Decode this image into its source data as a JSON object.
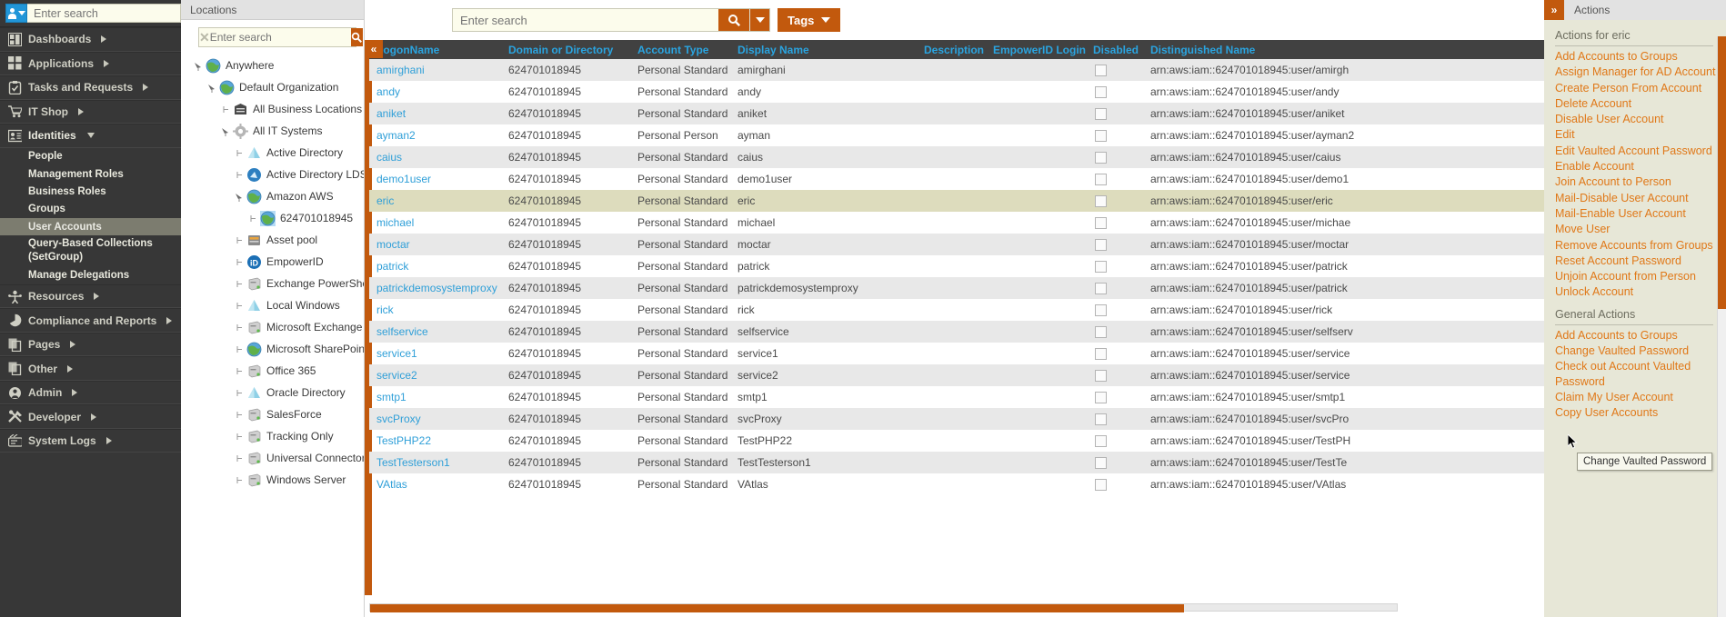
{
  "leftnav": {
    "search_placeholder": "Enter search",
    "avatar_icon": "user-avatar-icon",
    "items": [
      {
        "label": "Dashboards",
        "icon": "dashboard-icon",
        "arrow": "right"
      },
      {
        "label": "Applications",
        "icon": "applications-grid-icon",
        "arrow": "right"
      },
      {
        "label": "Tasks and Requests",
        "icon": "clipboard-icon",
        "arrow": "right"
      },
      {
        "label": "IT Shop",
        "icon": "shopping-cart-icon",
        "arrow": "right"
      },
      {
        "label": "Identities",
        "icon": "identities-card-icon",
        "arrow": "down"
      }
    ],
    "sub_items": [
      {
        "label": "People",
        "selected": false
      },
      {
        "label": "Management Roles",
        "selected": false
      },
      {
        "label": "Business Roles",
        "selected": false
      },
      {
        "label": "Groups",
        "selected": false
      },
      {
        "label": "User Accounts",
        "selected": true
      },
      {
        "label": "Query-Based Collections (SetGroup)",
        "selected": false
      },
      {
        "label": "Manage Delegations",
        "selected": false
      }
    ],
    "items_bottom": [
      {
        "label": "Resources",
        "icon": "resources-person-icon",
        "arrow": "right"
      },
      {
        "label": "Compliance and Reports",
        "icon": "pie-chart-icon",
        "arrow": "right"
      },
      {
        "label": "Pages",
        "icon": "pages-copy-icon",
        "arrow": "right"
      },
      {
        "label": "Other",
        "icon": "other-copy-icon",
        "arrow": "right"
      },
      {
        "label": "Admin",
        "icon": "admin-gear-person-icon",
        "arrow": "right"
      },
      {
        "label": "Developer",
        "icon": "hammer-wrench-icon",
        "arrow": "right"
      },
      {
        "label": "System Logs",
        "icon": "system-logs-icon",
        "arrow": "right"
      }
    ]
  },
  "locations": {
    "title": "Locations",
    "search_placeholder": "Enter search",
    "clear_icon": "clear-x-icon",
    "search_icon": "search-icon",
    "collapse_icon": "collapse-left-icon",
    "tree": [
      {
        "label": "Anywhere",
        "indent": 0,
        "icon": "globe-icon",
        "expanded": true,
        "selected": false
      },
      {
        "label": "Default Organization",
        "indent": 1,
        "icon": "globe-icon",
        "expanded": true,
        "selected": false
      },
      {
        "label": "All Business Locations",
        "indent": 2,
        "icon": "building-icon",
        "expanded": false,
        "selected": false
      },
      {
        "label": "All IT Systems",
        "indent": 2,
        "icon": "gear-icon",
        "expanded": true,
        "selected": false
      },
      {
        "label": "Active Directory",
        "indent": 3,
        "icon": "pyramid-icon",
        "expanded": false,
        "selected": false
      },
      {
        "label": "Active Directory LDS",
        "indent": 3,
        "icon": "blue-globe-icon",
        "expanded": false,
        "selected": false
      },
      {
        "label": "Amazon AWS",
        "indent": 3,
        "icon": "globe-icon",
        "expanded": true,
        "selected": false
      },
      {
        "label": "624701018945",
        "indent": 4,
        "icon": "globe-icon",
        "expanded": false,
        "selected": true
      },
      {
        "label": "Asset pool",
        "indent": 3,
        "icon": "asset-icon",
        "expanded": false,
        "selected": false
      },
      {
        "label": "EmpowerID",
        "indent": 3,
        "icon": "empowerid-icon",
        "expanded": false,
        "selected": false
      },
      {
        "label": "Exchange PowerShell",
        "indent": 3,
        "icon": "server-icon",
        "expanded": false,
        "selected": false
      },
      {
        "label": "Local Windows",
        "indent": 3,
        "icon": "pyramid-icon",
        "expanded": false,
        "selected": false
      },
      {
        "label": "Microsoft Exchange",
        "indent": 3,
        "icon": "server-icon",
        "expanded": false,
        "selected": false
      },
      {
        "label": "Microsoft SharePoint",
        "indent": 3,
        "icon": "globe-icon",
        "expanded": false,
        "selected": false
      },
      {
        "label": "Office 365",
        "indent": 3,
        "icon": "server-icon",
        "expanded": false,
        "selected": false
      },
      {
        "label": "Oracle Directory",
        "indent": 3,
        "icon": "pyramid-icon",
        "expanded": false,
        "selected": false
      },
      {
        "label": "SalesForce",
        "indent": 3,
        "icon": "server-icon",
        "expanded": false,
        "selected": false
      },
      {
        "label": "Tracking Only",
        "indent": 3,
        "icon": "server-icon",
        "expanded": false,
        "selected": false
      },
      {
        "label": "Universal Connector",
        "indent": 3,
        "icon": "server-icon",
        "expanded": false,
        "selected": false
      },
      {
        "label": "Windows Server",
        "indent": 3,
        "icon": "server-icon",
        "expanded": false,
        "selected": false
      }
    ]
  },
  "toolbar": {
    "search_placeholder": "Enter search",
    "search_icon": "search-icon",
    "search_dropdown_icon": "chevron-down-icon",
    "tags_label": "Tags",
    "tags_caret_icon": "chevron-down-icon",
    "collapse_label": "«"
  },
  "grid": {
    "columns": [
      {
        "key": "logon",
        "label": "LogonName"
      },
      {
        "key": "domain",
        "label": "Domain or Directory"
      },
      {
        "key": "type",
        "label": "Account Type"
      },
      {
        "key": "display",
        "label": "Display Name"
      },
      {
        "key": "desc",
        "label": "Description"
      },
      {
        "key": "login",
        "label": "EmpowerID Login"
      },
      {
        "key": "disabled",
        "label": "Disabled"
      },
      {
        "key": "dn",
        "label": "Distinguished Name"
      }
    ],
    "rows": [
      {
        "logon": "amirghani",
        "domain": "624701018945",
        "type": "Personal Standard",
        "display": "amirghani",
        "desc": "",
        "login": "",
        "disabled": false,
        "dn": "arn:aws:iam::624701018945:user/amirgh",
        "selected": false
      },
      {
        "logon": "andy",
        "domain": "624701018945",
        "type": "Personal Standard",
        "display": "andy",
        "desc": "",
        "login": "",
        "disabled": false,
        "dn": "arn:aws:iam::624701018945:user/andy",
        "selected": false
      },
      {
        "logon": "aniket",
        "domain": "624701018945",
        "type": "Personal Standard",
        "display": "aniket",
        "desc": "",
        "login": "",
        "disabled": false,
        "dn": "arn:aws:iam::624701018945:user/aniket",
        "selected": false
      },
      {
        "logon": "ayman2",
        "domain": "624701018945",
        "type": "Personal Person",
        "display": "ayman",
        "desc": "",
        "login": "",
        "disabled": false,
        "dn": "arn:aws:iam::624701018945:user/ayman2",
        "selected": false
      },
      {
        "logon": "caius",
        "domain": "624701018945",
        "type": "Personal Standard",
        "display": "caius",
        "desc": "",
        "login": "",
        "disabled": false,
        "dn": "arn:aws:iam::624701018945:user/caius",
        "selected": false
      },
      {
        "logon": "demo1user",
        "domain": "624701018945",
        "type": "Personal Standard",
        "display": "demo1user",
        "desc": "",
        "login": "",
        "disabled": false,
        "dn": "arn:aws:iam::624701018945:user/demo1",
        "selected": false
      },
      {
        "logon": "eric",
        "domain": "624701018945",
        "type": "Personal Standard",
        "display": "eric",
        "desc": "",
        "login": "",
        "disabled": false,
        "dn": "arn:aws:iam::624701018945:user/eric",
        "selected": true
      },
      {
        "logon": "michael",
        "domain": "624701018945",
        "type": "Personal Standard",
        "display": "michael",
        "desc": "",
        "login": "",
        "disabled": false,
        "dn": "arn:aws:iam::624701018945:user/michae",
        "selected": false
      },
      {
        "logon": "moctar",
        "domain": "624701018945",
        "type": "Personal Standard",
        "display": "moctar",
        "desc": "",
        "login": "",
        "disabled": false,
        "dn": "arn:aws:iam::624701018945:user/moctar",
        "selected": false
      },
      {
        "logon": "patrick",
        "domain": "624701018945",
        "type": "Personal Standard",
        "display": "patrick",
        "desc": "",
        "login": "",
        "disabled": false,
        "dn": "arn:aws:iam::624701018945:user/patrick",
        "selected": false
      },
      {
        "logon": "patrickdemosystemproxy",
        "domain": "624701018945",
        "type": "Personal Standard",
        "display": "patrickdemosystemproxy",
        "desc": "",
        "login": "",
        "disabled": false,
        "dn": "arn:aws:iam::624701018945:user/patrick",
        "selected": false
      },
      {
        "logon": "rick",
        "domain": "624701018945",
        "type": "Personal Standard",
        "display": "rick",
        "desc": "",
        "login": "",
        "disabled": false,
        "dn": "arn:aws:iam::624701018945:user/rick",
        "selected": false
      },
      {
        "logon": "selfservice",
        "domain": "624701018945",
        "type": "Personal Standard",
        "display": "selfservice",
        "desc": "",
        "login": "",
        "disabled": false,
        "dn": "arn:aws:iam::624701018945:user/selfserv",
        "selected": false
      },
      {
        "logon": "service1",
        "domain": "624701018945",
        "type": "Personal Standard",
        "display": "service1",
        "desc": "",
        "login": "",
        "disabled": false,
        "dn": "arn:aws:iam::624701018945:user/service",
        "selected": false
      },
      {
        "logon": "service2",
        "domain": "624701018945",
        "type": "Personal Standard",
        "display": "service2",
        "desc": "",
        "login": "",
        "disabled": false,
        "dn": "arn:aws:iam::624701018945:user/service",
        "selected": false
      },
      {
        "logon": "smtp1",
        "domain": "624701018945",
        "type": "Personal Standard",
        "display": "smtp1",
        "desc": "",
        "login": "",
        "disabled": false,
        "dn": "arn:aws:iam::624701018945:user/smtp1",
        "selected": false
      },
      {
        "logon": "svcProxy",
        "domain": "624701018945",
        "type": "Personal Standard",
        "display": "svcProxy",
        "desc": "",
        "login": "",
        "disabled": false,
        "dn": "arn:aws:iam::624701018945:user/svcPro",
        "selected": false
      },
      {
        "logon": "TestPHP22",
        "domain": "624701018945",
        "type": "Personal Standard",
        "display": "TestPHP22",
        "desc": "",
        "login": "",
        "disabled": false,
        "dn": "arn:aws:iam::624701018945:user/TestPH",
        "selected": false
      },
      {
        "logon": "TestTesterson1",
        "domain": "624701018945",
        "type": "Personal Standard",
        "display": "TestTesterson1",
        "desc": "",
        "login": "",
        "disabled": false,
        "dn": "arn:aws:iam::624701018945:user/TestTe",
        "selected": false
      },
      {
        "logon": "VAtlas",
        "domain": "624701018945",
        "type": "Personal Standard",
        "display": "VAtlas",
        "desc": "",
        "login": "",
        "disabled": false,
        "dn": "arn:aws:iam::624701018945:user/VAtlas",
        "selected": false
      }
    ]
  },
  "actions": {
    "panel_title": "Actions",
    "expand_icon": "expand-right-icon",
    "context_heading": "Actions for eric",
    "context_links": [
      "Add Accounts to Groups",
      "Assign Manager for AD Account",
      "Create Person From Account",
      "Delete Account",
      "Disable User Account",
      "Edit",
      "Edit Vaulted Account Password",
      "Enable Account",
      "Join Account to Person",
      "Mail-Disable User Account",
      "Mail-Enable User Account",
      "Move User",
      "Remove Accounts from Groups",
      "Reset Account Password",
      "Unjoin Account from Person",
      "Unlock Account"
    ],
    "general_heading": "General Actions",
    "general_links": [
      "Add Accounts to Groups",
      "Change Vaulted Password",
      "Check out Account Vaulted Password",
      "Claim My User Account",
      "Copy User Accounts"
    ],
    "tooltip_text": "Change Vaulted Password"
  },
  "colors": {
    "accent_orange": "#c2590d",
    "link_blue": "#2f9fd8",
    "action_orange": "#e07818",
    "sidebar_dark": "#373737",
    "selected_row": "#dddcbd"
  }
}
